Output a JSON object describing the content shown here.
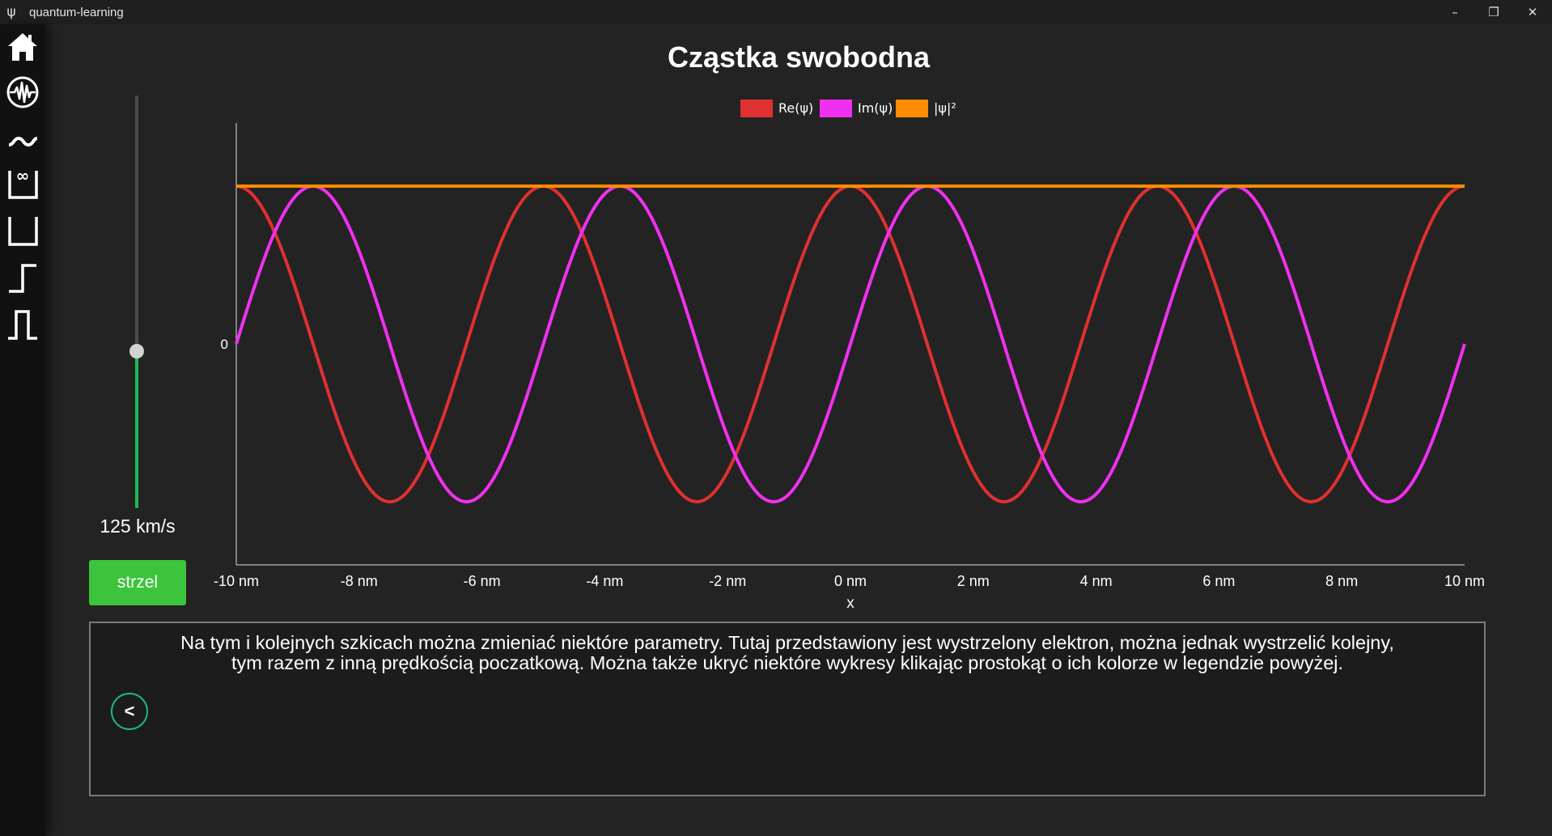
{
  "window": {
    "icon": "psi-icon",
    "icon_glyph": "ψ",
    "title": "quantum-learning",
    "controls": {
      "minimize": "–",
      "maximize": "❐",
      "close": "✕"
    }
  },
  "sidebar": {
    "items": [
      {
        "id": "home",
        "icon": "home-icon"
      },
      {
        "id": "wave-packet",
        "icon": "waveform-circle-icon"
      },
      {
        "id": "free-particle",
        "icon": "wave-icon"
      },
      {
        "id": "infinite-well",
        "icon": "infinite-well-icon",
        "glyph": "∞"
      },
      {
        "id": "finite-well",
        "icon": "finite-well-icon"
      },
      {
        "id": "potential-step",
        "icon": "step-icon"
      },
      {
        "id": "potential-barrier",
        "icon": "barrier-icon"
      }
    ]
  },
  "page": {
    "title": "Cząstka swobodna"
  },
  "slider": {
    "value_fraction": 0.38,
    "label": "125 km/s",
    "fill_color": "#1db954"
  },
  "fire_button": {
    "label": "strzel"
  },
  "chart_data": {
    "type": "line",
    "title": "",
    "xlabel": "x",
    "ylabel": "",
    "xlim": [
      -10,
      10
    ],
    "ylim": [
      -1.4,
      1.4
    ],
    "x_ticks": [
      "-10 nm",
      "-8 nm",
      "-6 nm",
      "-4 nm",
      "-2 nm",
      "0 nm",
      "2 nm",
      "4 nm",
      "6 nm",
      "8 nm",
      "10 nm"
    ],
    "x_tick_values": [
      -10,
      -8,
      -6,
      -4,
      -2,
      0,
      2,
      4,
      6,
      8,
      10
    ],
    "y_ticks": [
      "0"
    ],
    "y_tick_values": [
      0
    ],
    "grid": false,
    "legend_position": "top-center",
    "wavelength_nm": 5.0,
    "series": [
      {
        "name": "Re(ψ)",
        "color": "#e03030",
        "func": "cos",
        "amplitude": 1
      },
      {
        "name": "Im(ψ)",
        "color": "#f030f0",
        "func": "sin",
        "amplitude": 1
      },
      {
        "name": "|ψ|²",
        "color": "#ff8c00",
        "func": "const",
        "amplitude": 1
      }
    ]
  },
  "info": {
    "line1": "Na tym i kolejnych szkicach można zmieniać niektóre parametry. Tutaj przedstawiony jest wystrzelony elektron, można jednak wystrzelić kolejny,",
    "line2": "tym razem z inną prędkością poczatkową. Można także ukryć niektóre wykresy klikając prostokąt o ich kolorze w legendzie powyżej.",
    "back_label": "<"
  }
}
